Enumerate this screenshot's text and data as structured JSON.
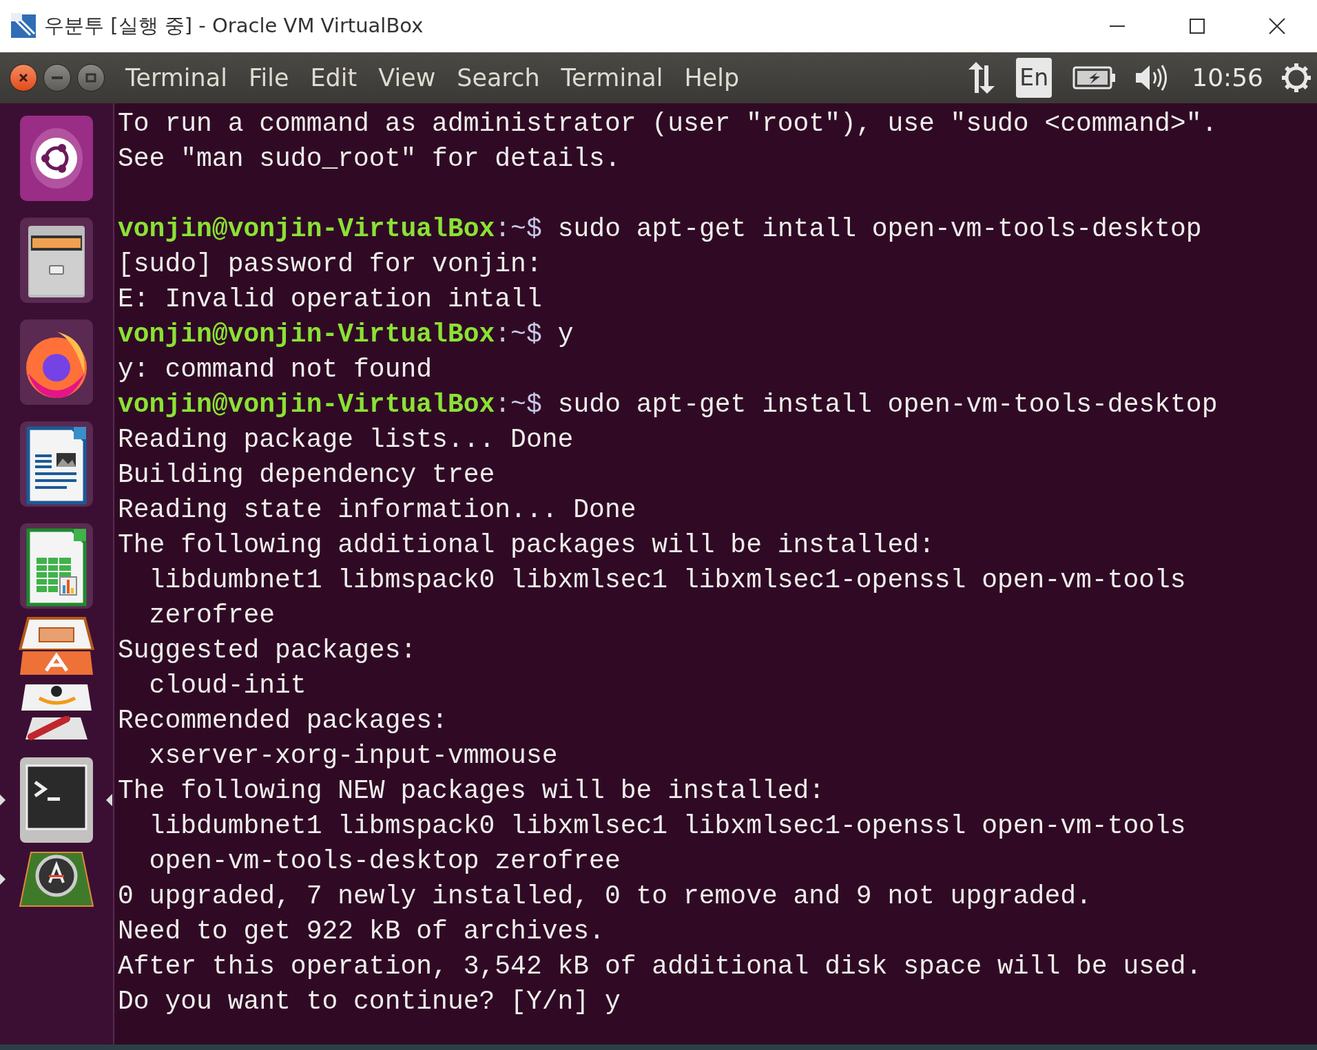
{
  "window": {
    "title": "우분투 [실행 중] - Oracle VM VirtualBox"
  },
  "panel": {
    "menus": [
      {
        "label": "Terminal"
      },
      {
        "label": "File"
      },
      {
        "label": "Edit"
      },
      {
        "label": "View"
      },
      {
        "label": "Search"
      },
      {
        "label": "Terminal"
      },
      {
        "label": "Help"
      }
    ],
    "keyboard": "En",
    "clock": "10:56"
  },
  "launcher": {
    "items": [
      {
        "kind": "dash",
        "folded": false,
        "running": false,
        "focused": false
      },
      {
        "kind": "files",
        "folded": false,
        "running": false,
        "focused": false
      },
      {
        "kind": "firefox",
        "folded": false,
        "running": false,
        "focused": false
      },
      {
        "kind": "writer",
        "folded": false,
        "running": false,
        "focused": false
      },
      {
        "kind": "calc",
        "folded": false,
        "running": false,
        "focused": false
      },
      {
        "kind": "impress",
        "folded": true,
        "running": false,
        "focused": false
      },
      {
        "kind": "software",
        "folded": true,
        "running": false,
        "focused": false
      },
      {
        "kind": "amazon",
        "folded": true,
        "running": false,
        "focused": false
      },
      {
        "kind": "settings",
        "folded": true,
        "running": false,
        "focused": false
      },
      {
        "kind": "terminal",
        "folded": false,
        "running": true,
        "focused": true
      },
      {
        "kind": "updater",
        "folded": true,
        "running": true,
        "focused": false
      }
    ]
  },
  "terminal": {
    "lines": [
      {
        "kind": "output",
        "text": "To run a command as administrator (user \"root\"), use \"sudo <command>\"."
      },
      {
        "kind": "output",
        "text": "See \"man sudo_root\" for details."
      },
      {
        "kind": "blank"
      },
      {
        "kind": "prompt",
        "user_host": "vonjin@vonjin-VirtualBox",
        "path": ":~$",
        "command": "sudo apt-get intall open-vm-tools-desktop"
      },
      {
        "kind": "output",
        "text": "[sudo] password for vonjin:"
      },
      {
        "kind": "output",
        "text": "E: Invalid operation intall"
      },
      {
        "kind": "prompt",
        "user_host": "vonjin@vonjin-VirtualBox",
        "path": ":~$",
        "command": "y"
      },
      {
        "kind": "output",
        "text": "y: command not found"
      },
      {
        "kind": "prompt",
        "user_host": "vonjin@vonjin-VirtualBox",
        "path": ":~$",
        "command": "sudo apt-get install open-vm-tools-desktop"
      },
      {
        "kind": "output",
        "text": "Reading package lists... Done"
      },
      {
        "kind": "output",
        "text": "Building dependency tree"
      },
      {
        "kind": "output",
        "text": "Reading state information... Done"
      },
      {
        "kind": "output",
        "text": "The following additional packages will be installed:"
      },
      {
        "kind": "output",
        "text": "  libdumbnet1 libmspack0 libxmlsec1 libxmlsec1-openssl open-vm-tools"
      },
      {
        "kind": "output",
        "text": "  zerofree"
      },
      {
        "kind": "output",
        "text": "Suggested packages:"
      },
      {
        "kind": "output",
        "text": "  cloud-init"
      },
      {
        "kind": "output",
        "text": "Recommended packages:"
      },
      {
        "kind": "output",
        "text": "  xserver-xorg-input-vmmouse"
      },
      {
        "kind": "output",
        "text": "The following NEW packages will be installed:"
      },
      {
        "kind": "output",
        "text": "  libdumbnet1 libmspack0 libxmlsec1 libxmlsec1-openssl open-vm-tools"
      },
      {
        "kind": "output",
        "text": "  open-vm-tools-desktop zerofree"
      },
      {
        "kind": "output",
        "text": "0 upgraded, 7 newly installed, 0 to remove and 9 not upgraded."
      },
      {
        "kind": "output",
        "text": "Need to get 922 kB of archives."
      },
      {
        "kind": "output",
        "text": "After this operation, 3,542 kB of additional disk space will be used."
      },
      {
        "kind": "output",
        "text": "Do you want to continue? [Y/n] y"
      }
    ]
  }
}
